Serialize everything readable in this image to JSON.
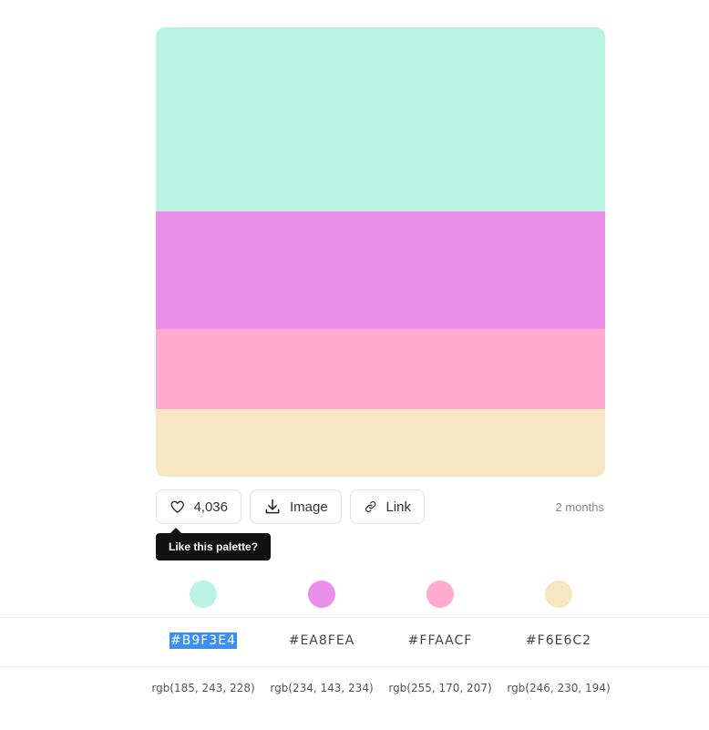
{
  "palette": {
    "colors": [
      {
        "hex": "#B9F3E4",
        "rgb": "rgb(185, 243, 228)",
        "swatch": "#B9F3E4"
      },
      {
        "hex": "#EA8FEA",
        "rgb": "rgb(234, 143, 234)",
        "swatch": "#EA8FEA"
      },
      {
        "hex": "#FFAACF",
        "rgb": "rgb(255, 170, 207)",
        "swatch": "#FFAACF"
      },
      {
        "hex": "#F6E6C2",
        "rgb": "rgb(246, 230, 194)",
        "swatch": "#F6E6C2"
      }
    ]
  },
  "actions": {
    "likes": "4,036",
    "image_label": "Image",
    "link_label": "Link",
    "posted": "2 months"
  },
  "tooltip": {
    "text": "Like this palette?"
  },
  "icons": [
    "heart-icon",
    "download-icon",
    "link-icon"
  ]
}
